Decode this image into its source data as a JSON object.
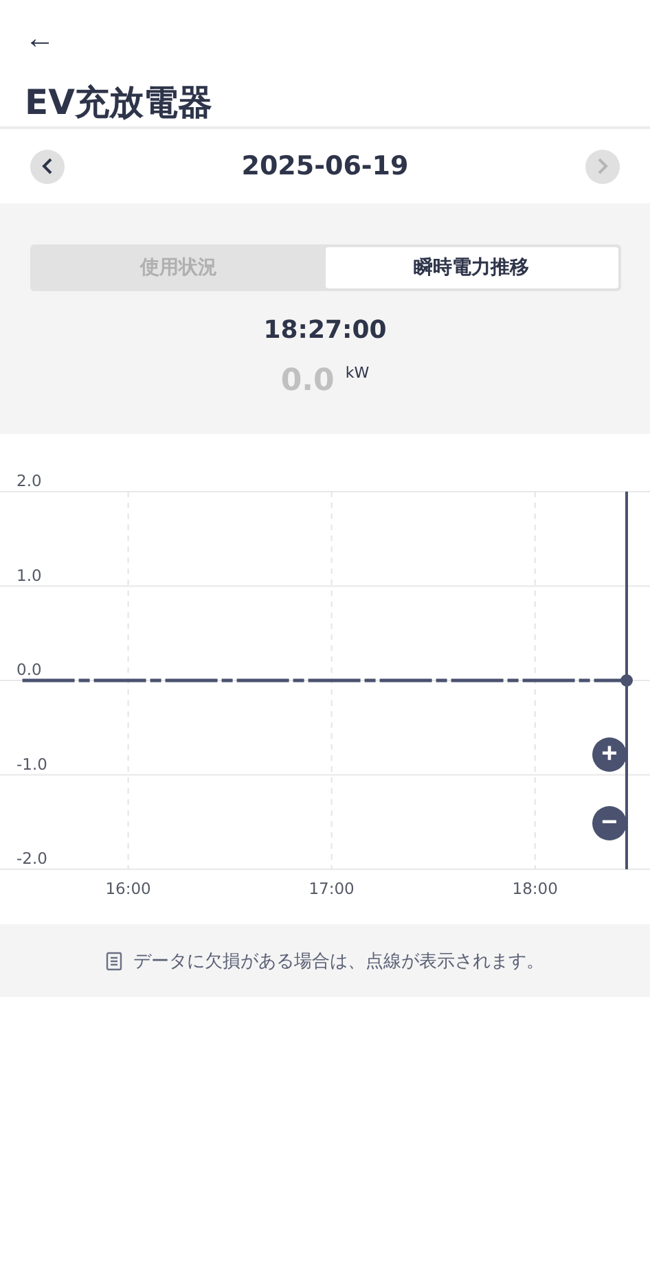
{
  "header": {
    "back": "←",
    "title": "EV充放電器"
  },
  "date_nav": {
    "date": "2025-06-19",
    "prev_disabled": false,
    "next_disabled": true
  },
  "tabs": [
    {
      "label": "使用状況",
      "selected": false
    },
    {
      "label": "瞬時電力推移",
      "selected": true
    }
  ],
  "reading": {
    "time": "18:27:00",
    "value": "0.0",
    "unit": "kW"
  },
  "chart": {
    "chart_data": {
      "type": "line",
      "x": [
        15.48,
        18.45
      ],
      "grid": true,
      "series": [
        {
          "color": "#4a5270",
          "line_style": "dashed",
          "values": [
            0,
            0
          ]
        }
      ],
      "xlim": [
        15.37,
        18.45
      ],
      "ylim": [
        -2,
        2
      ],
      "xticks": [
        {
          "value": 16,
          "label": "16:00"
        },
        {
          "value": 17,
          "label": "17:00"
        },
        {
          "value": 18,
          "label": "18:00"
        }
      ],
      "yticks": [
        {
          "value": 2,
          "label": "2.0"
        },
        {
          "value": 1,
          "label": "1.0"
        },
        {
          "value": 0,
          "label": "0.0"
        },
        {
          "value": -1,
          "label": "-1.0"
        },
        {
          "value": -2,
          "label": "-2.0"
        }
      ]
    },
    "zoom_in": "+",
    "zoom_out": "−"
  },
  "note": "データに欠損がある場合は、点線が表示されます。"
}
